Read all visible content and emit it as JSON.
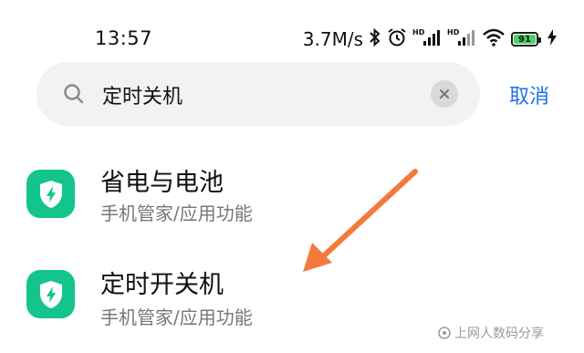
{
  "status_bar": {
    "time": "13:57",
    "network_speed": "3.7M/s",
    "battery_level": "91",
    "icons": [
      "bluetooth-icon",
      "alarm-icon",
      "hd-signal-icon",
      "hd-signal-icon",
      "wifi-icon",
      "battery-icon",
      "charging-icon"
    ]
  },
  "search": {
    "query": "定时关机",
    "cancel_label": "取消"
  },
  "results": [
    {
      "title": "省电与电池",
      "subtitle": "手机管家/应用功能",
      "icon": "shield-bolt-icon"
    },
    {
      "title": "定时开关机",
      "subtitle": "手机管家/应用功能",
      "icon": "shield-bolt-icon"
    }
  ],
  "annotation": {
    "arrow_color": "#f37a3d"
  },
  "watermark": {
    "text": "上网人数码分享"
  },
  "colors": {
    "accent": "#1d72e8",
    "app_icon": "#14c48d",
    "battery_fill": "#4cd263"
  }
}
